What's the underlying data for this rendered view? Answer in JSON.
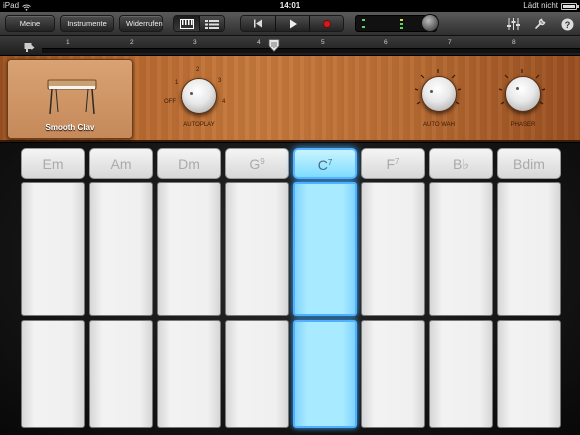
{
  "status": {
    "device": "iPad",
    "time": "14:01",
    "charging": "Lädt nicht"
  },
  "toolbar": {
    "my_songs": "Meine Songs",
    "instruments": "Instrumente",
    "undo": "Widerrufen",
    "view_modes": [
      "chords-view-icon",
      "tracks-view-icon"
    ],
    "active_view": 0,
    "transport": [
      "rewind-icon",
      "play-icon",
      "record-icon"
    ],
    "record_color": "#e02020"
  },
  "ruler": {
    "bars": [
      "1",
      "2",
      "3",
      "4",
      "5",
      "6",
      "7",
      "8"
    ]
  },
  "instrument": {
    "name": "Smooth Clav",
    "autoplay": {
      "label": "AUTOPLAY",
      "positions": [
        "OFF",
        "1",
        "2",
        "3",
        "4"
      ]
    },
    "auto_wah": "AUTO WAH",
    "phaser": "PHASER"
  },
  "chords": [
    {
      "root": "Em",
      "ext": ""
    },
    {
      "root": "Am",
      "ext": ""
    },
    {
      "root": "Dm",
      "ext": ""
    },
    {
      "root": "G",
      "ext": "9"
    },
    {
      "root": "C",
      "ext": "7"
    },
    {
      "root": "F",
      "ext": "7"
    },
    {
      "root": "B♭",
      "ext": ""
    },
    {
      "root": "Bdim",
      "ext": ""
    }
  ],
  "active_chord_index": 4,
  "accent_color": "#5ab4ff"
}
